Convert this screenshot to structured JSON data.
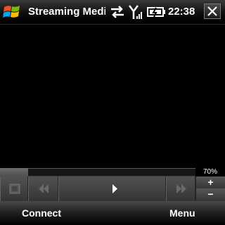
{
  "titlebar": {
    "app_title": "Streaming Medi",
    "clock": "22:38",
    "icons": [
      "windows-start-icon",
      "connection-arrows-icon",
      "signal-antenna-icon",
      "battery-charging-icon",
      "close-icon"
    ]
  },
  "player": {
    "volume_label": "70%",
    "volume_up_label": "+",
    "volume_down_label": "−",
    "controls": [
      "stop-icon",
      "rewind-icon",
      "play-icon",
      "fast-forward-icon"
    ]
  },
  "softkeys": {
    "left": "Connect",
    "right": "Menu"
  }
}
